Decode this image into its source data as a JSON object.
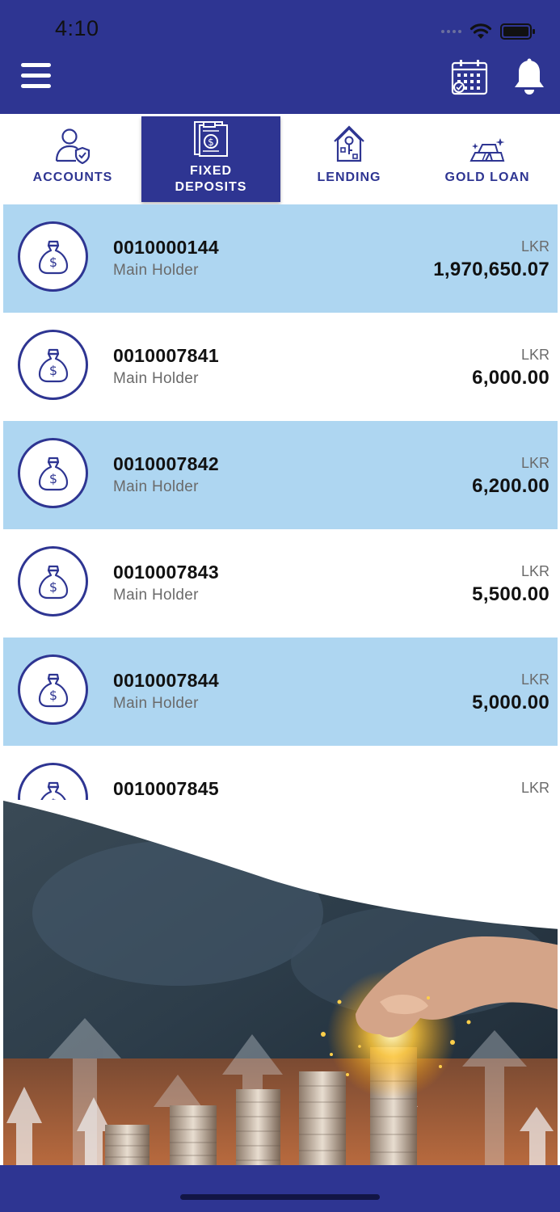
{
  "status_bar": {
    "time": "4:10"
  },
  "header": {
    "menu_icon": "hamburger-menu-icon",
    "calendar_icon": "calendar-icon",
    "bell_icon": "bell-icon"
  },
  "tabs": [
    {
      "label": "ACCOUNTS",
      "icon": "user-shield-icon",
      "active": false
    },
    {
      "label": "FIXED\nDEPOSITS",
      "icon": "deposit-document-icon",
      "active": true
    },
    {
      "label": "LENDING",
      "icon": "house-key-icon",
      "active": false
    },
    {
      "label": "GOLD LOAN",
      "icon": "gold-bars-icon",
      "active": false
    }
  ],
  "deposits": [
    {
      "account_no": "0010000144",
      "holder": "Main Holder",
      "currency": "LKR",
      "amount": "1,970,650.07"
    },
    {
      "account_no": "0010007841",
      "holder": "Main Holder",
      "currency": "LKR",
      "amount": "6,000.00"
    },
    {
      "account_no": "0010007842",
      "holder": "Main Holder",
      "currency": "LKR",
      "amount": "6,200.00"
    },
    {
      "account_no": "0010007843",
      "holder": "Main Holder",
      "currency": "LKR",
      "amount": "5,500.00"
    },
    {
      "account_no": "0010007844",
      "holder": "Main Holder",
      "currency": "LKR",
      "amount": "5,000.00"
    },
    {
      "account_no": "0010007845",
      "holder": "",
      "currency": "LKR",
      "amount": ""
    }
  ],
  "colors": {
    "primary": "#2e3592",
    "row_highlight": "#aed6f1",
    "text_dark": "#111111",
    "text_muted": "#6a6a6a"
  }
}
